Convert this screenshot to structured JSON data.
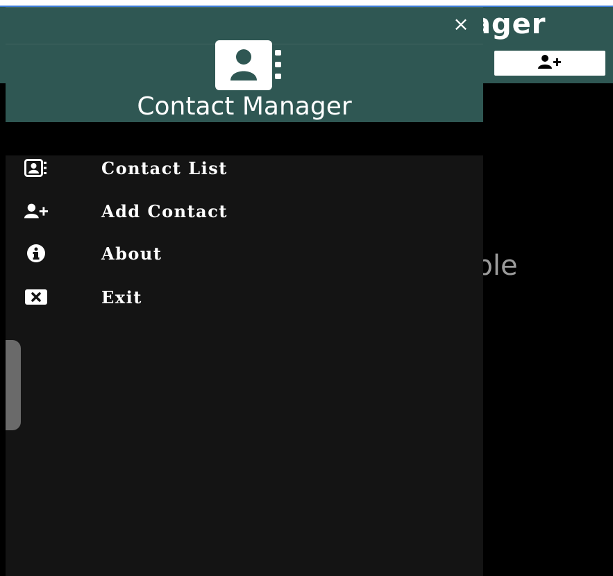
{
  "app": {
    "title_fragment": "ager",
    "empty_text_fragment": "able",
    "add_button_icon": "user-plus-icon"
  },
  "drawer": {
    "title": "Contact Manager",
    "logo_icon": "address-book-icon",
    "close_label": "×",
    "menu": [
      {
        "label": "Contact List",
        "icon": "address-card-icon"
      },
      {
        "label": "Add Contact",
        "icon": "user-plus-icon"
      },
      {
        "label": "About",
        "icon": "info-circle-icon"
      },
      {
        "label": "Exit",
        "icon": "close-box-icon"
      }
    ]
  },
  "colors": {
    "header": "#2f5753",
    "drawer_bg": "#141414",
    "text": "#ffffff",
    "accent_line": "#3b7bd8"
  }
}
